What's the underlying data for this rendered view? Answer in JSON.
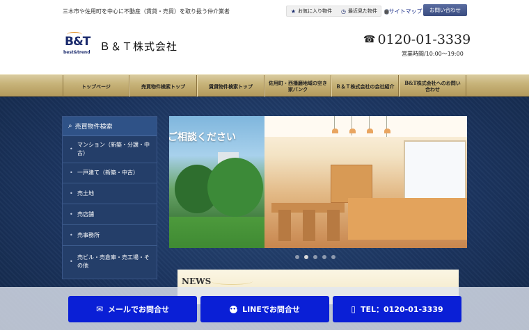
{
  "header": {
    "tagline": "三木市や佐用町を中心に不動産（賃貸・売買）を取り扱う仲介業者",
    "util_links": [
      {
        "label": "お気に入り物件",
        "icon": "star-icon"
      },
      {
        "label": "最近見た物件",
        "icon": "history-icon"
      }
    ],
    "sitemap_label": "サイトマップ",
    "contact_label": "お問い合わせ",
    "logo_main": "B&T",
    "logo_sub": "best&trend",
    "company_name": "Ｂ＆Ｔ株式会社",
    "phone": "0120-01-3339",
    "hours": "営業時間/10:00～19:00"
  },
  "nav": {
    "items": [
      "トップページ",
      "売買物件検索トップ",
      "賃貸物件検索トップ",
      "佐用町・西播磨地域の空き家バンク",
      "Ｂ＆Ｔ株式会社の会社紹介",
      "B&T株式会社へのお問い合わせ"
    ]
  },
  "sidebar": {
    "title": "売買物件検索",
    "items": [
      "マンション（新築・分譲・中古）",
      "一戸建て（新築・中古）",
      "売土地",
      "売店舗",
      "売事務所",
      "売ビル・売倉庫・売工場・その他"
    ]
  },
  "slider": {
    "caption": "ご相談ください",
    "dot_count": 5,
    "active_index": 1
  },
  "news": {
    "title": "NEWS"
  },
  "bottom_bar": {
    "mail_label": "メールでお問合せ",
    "line_label": "LINEでお問合せ",
    "tel_label": "TEL：0120-01-3339"
  },
  "colors": {
    "accent_navy": "#1a2a6c",
    "cta_blue": "#0a1fd6",
    "nav_gold": "#c8b47a"
  }
}
